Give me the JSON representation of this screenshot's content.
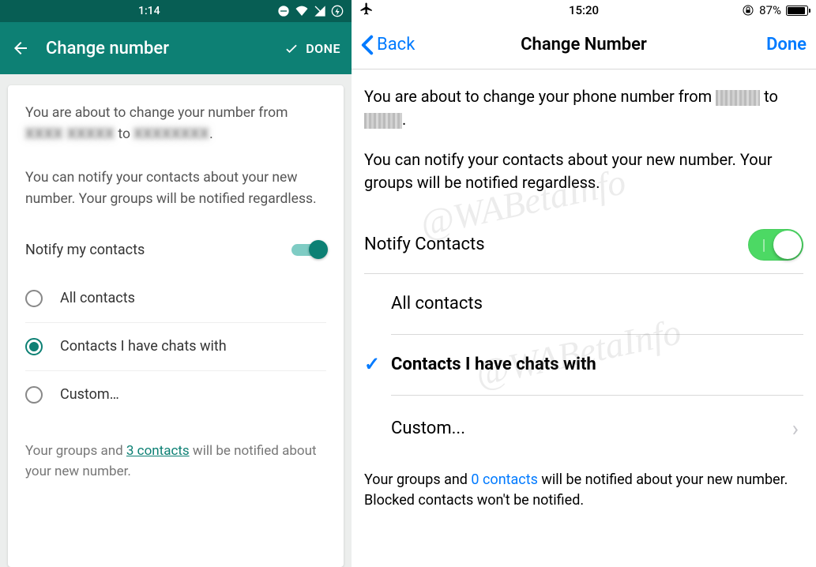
{
  "android": {
    "status": {
      "time": "1:14"
    },
    "appbar": {
      "title": "Change number",
      "done": "DONE"
    },
    "intro_prefix": "You are about to change your number from ",
    "intro_mid": " to ",
    "intro_suffix": ".",
    "notify_info": "You can notify your contacts about your new number. Your groups will be notified regardless.",
    "notify_label": "Notify my contacts",
    "options": {
      "all": "All contacts",
      "chats": "Contacts I have chats with",
      "custom": "Custom…"
    },
    "footer_prefix": "Your groups and ",
    "footer_link": "3 contacts",
    "footer_suffix": " will be notified about your new number."
  },
  "ios": {
    "status": {
      "time": "15:20",
      "battery": "87%"
    },
    "nav": {
      "back": "Back",
      "title": "Change Number",
      "done": "Done"
    },
    "intro_prefix": "You are about to change your phone number from ",
    "intro_mid": " to ",
    "intro_suffix": ".",
    "notify_info": "You can notify your contacts about your new number. Your groups will be notified regardless.",
    "notify_label": "Notify Contacts",
    "options": {
      "all": "All contacts",
      "chats": "Contacts I have chats with",
      "custom": "Custom..."
    },
    "footer_prefix": "Your groups and ",
    "footer_link": "0 contacts",
    "footer_suffix": " will be notified about your new number. Blocked contacts won't be notified."
  },
  "watermark": "@WABetaInfo"
}
